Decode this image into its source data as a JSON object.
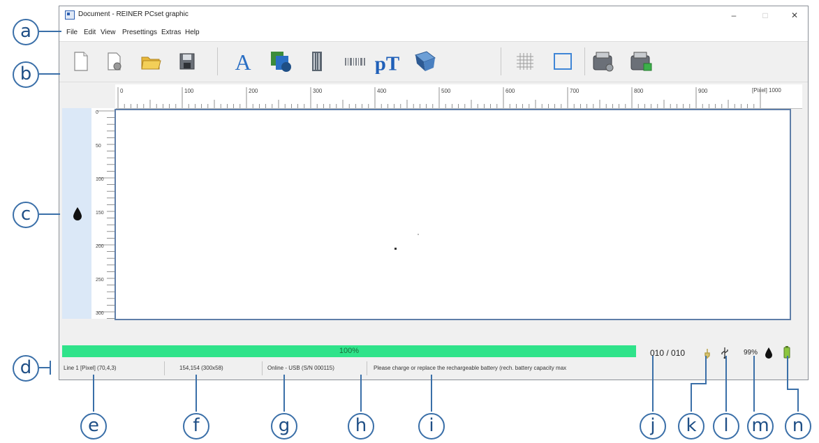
{
  "window": {
    "title": "Document - REINER PCset graphic",
    "controls": {
      "minimize": "–",
      "maximize": "□",
      "close": "✕"
    }
  },
  "menu": [
    "File",
    "Edit",
    "View",
    "Presettings",
    "Extras",
    "Help"
  ],
  "toolbar": {
    "buttons": [
      "new-document-icon",
      "open-template-icon",
      "open-folder-icon",
      "save-disk-icon",
      "text-icon",
      "image-icon",
      "barcode-vertical-icon",
      "barcode-horizontal-icon",
      "text-format-icon",
      "transfer-icon",
      "grid-icon",
      "frame-icon",
      "printer-settings-icon",
      "printer-send-icon"
    ]
  },
  "ruler_h": {
    "labels": [
      "0",
      "100",
      "200",
      "300",
      "400",
      "500",
      "600",
      "700",
      "800",
      "900"
    ],
    "unit": "[Pixel] 1000"
  },
  "ruler_v": {
    "labels": [
      "0",
      "50",
      "100",
      "150",
      "200",
      "250",
      "300"
    ]
  },
  "progress": {
    "label": "100%",
    "fraction": 1.0
  },
  "status": {
    "position": "Line 1 [Pixel] (70,4,3)",
    "size": "154,154 (300x58)",
    "connection": "Online - USB (S/N 000115)",
    "message": "Please charge or replace the rechargeable battery (rech. battery capacity max",
    "counter": "010 / 010",
    "ink": "99%"
  },
  "callouts": [
    "a",
    "b",
    "c",
    "d",
    "e",
    "f",
    "g",
    "h",
    "i",
    "j",
    "k",
    "l",
    "m",
    "n"
  ],
  "colors": {
    "progress": "#2fe38a",
    "accent": "#2a5db0",
    "callout": "#3a6fa8"
  }
}
